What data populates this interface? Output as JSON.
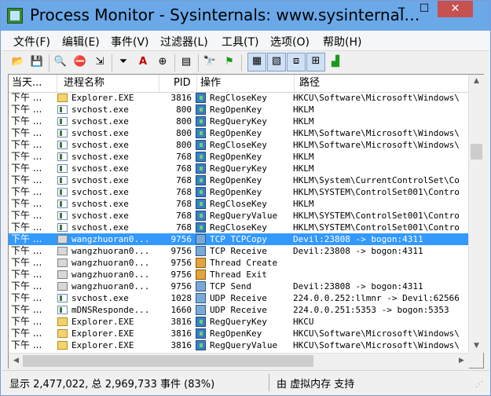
{
  "window": {
    "title": "Process Monitor - Sysinternals: www.sysinternal…",
    "minimize_glyph": "─",
    "maximize_glyph": "☐",
    "close_glyph": "✕"
  },
  "menu": [
    "文件(F)",
    "编辑(E)",
    "事件(V)",
    "过滤器(L)",
    "工具(T)",
    "选项(O)",
    "帮助(H)"
  ],
  "toolbar": {
    "buttons": [
      {
        "icon": "open-folder-icon",
        "glyph": "📂"
      },
      {
        "icon": "save-icon",
        "glyph": "💾"
      },
      {
        "icon": "magnify-icon",
        "glyph": "🔍"
      },
      {
        "icon": "capture-toggle-icon",
        "glyph": "⛔"
      },
      {
        "icon": "autoscroll-icon",
        "glyph": "⇲"
      },
      {
        "icon": "filter-icon",
        "glyph": "⏷"
      },
      {
        "icon": "highlight-icon",
        "glyph": "A"
      },
      {
        "icon": "target-icon",
        "glyph": "⊕"
      },
      {
        "icon": "jump-icon",
        "glyph": "▤"
      },
      {
        "icon": "find-icon",
        "glyph": "🔭"
      },
      {
        "icon": "jump-to-icon",
        "glyph": "⚑"
      },
      {
        "icon": "registry-activity-icon",
        "glyph": "▦"
      },
      {
        "icon": "filesystem-activity-icon",
        "glyph": "▧"
      },
      {
        "icon": "network-activity-icon",
        "glyph": "⧈"
      },
      {
        "icon": "process-activity-icon",
        "glyph": "⊞"
      },
      {
        "icon": "profiling-activity-icon",
        "glyph": "▟"
      }
    ]
  },
  "columns": {
    "time": "当天...",
    "process": "进程名称",
    "pid": "PID",
    "operation": "操作",
    "path": "路径"
  },
  "rows": [
    {
      "time": "下午 ...",
      "pkind": "explorer",
      "process": "Explorer.EXE",
      "pid": "3816",
      "okind": "reg",
      "operation": "RegCloseKey",
      "path": "HKCU\\Software\\Microsoft\\Windows\\"
    },
    {
      "time": "下午 ...",
      "pkind": "svc",
      "process": "svchost.exe",
      "pid": "800",
      "okind": "reg",
      "operation": "RegOpenKey",
      "path": "HKLM"
    },
    {
      "time": "下午 ...",
      "pkind": "svc",
      "process": "svchost.exe",
      "pid": "800",
      "okind": "reg",
      "operation": "RegQueryKey",
      "path": "HKLM"
    },
    {
      "time": "下午 ...",
      "pkind": "svc",
      "process": "svchost.exe",
      "pid": "800",
      "okind": "reg",
      "operation": "RegOpenKey",
      "path": "HKLM\\Software\\Microsoft\\Windows\\"
    },
    {
      "time": "下午 ...",
      "pkind": "svc",
      "process": "svchost.exe",
      "pid": "800",
      "okind": "reg",
      "operation": "RegCloseKey",
      "path": "HKLM\\Software\\Microsoft\\Windows\\"
    },
    {
      "time": "下午 ...",
      "pkind": "svc",
      "process": "svchost.exe",
      "pid": "768",
      "okind": "reg",
      "operation": "RegOpenKey",
      "path": "HKLM"
    },
    {
      "time": "下午 ...",
      "pkind": "svc",
      "process": "svchost.exe",
      "pid": "768",
      "okind": "reg",
      "operation": "RegQueryKey",
      "path": "HKLM"
    },
    {
      "time": "下午 ...",
      "pkind": "svc",
      "process": "svchost.exe",
      "pid": "768",
      "okind": "reg",
      "operation": "RegOpenKey",
      "path": "HKLM\\System\\CurrentControlSet\\Co"
    },
    {
      "time": "下午 ...",
      "pkind": "svc",
      "process": "svchost.exe",
      "pid": "768",
      "okind": "reg",
      "operation": "RegOpenKey",
      "path": "HKLM\\SYSTEM\\ControlSet001\\Contro"
    },
    {
      "time": "下午 ...",
      "pkind": "svc",
      "process": "svchost.exe",
      "pid": "768",
      "okind": "reg",
      "operation": "RegCloseKey",
      "path": "HKLM"
    },
    {
      "time": "下午 ...",
      "pkind": "svc",
      "process": "svchost.exe",
      "pid": "768",
      "okind": "reg",
      "operation": "RegQueryValue",
      "path": "HKLM\\SYSTEM\\ControlSet001\\Contro"
    },
    {
      "time": "下午 ...",
      "pkind": "svc",
      "process": "svchost.exe",
      "pid": "768",
      "okind": "reg",
      "operation": "RegCloseKey",
      "path": "HKLM\\SYSTEM\\ControlSet001\\Contro"
    },
    {
      "time": "下午 ...",
      "pkind": "app",
      "process": "wangzhuoran0...",
      "pid": "9756",
      "okind": "net",
      "operation": "TCP TCPCopy",
      "path": "Devil:23808 -> bogon:4311",
      "selected": true
    },
    {
      "time": "下午 ...",
      "pkind": "app",
      "process": "wangzhuoran0...",
      "pid": "9756",
      "okind": "net",
      "operation": "TCP Receive",
      "path": "Devil:23808 -> bogon:4311"
    },
    {
      "time": "下午 ...",
      "pkind": "app",
      "process": "wangzhuoran0...",
      "pid": "9756",
      "okind": "thr",
      "operation": "Thread Create",
      "path": ""
    },
    {
      "time": "下午 ...",
      "pkind": "app",
      "process": "wangzhuoran0...",
      "pid": "9756",
      "okind": "thr",
      "operation": "Thread Exit",
      "path": ""
    },
    {
      "time": "下午 ...",
      "pkind": "app",
      "process": "wangzhuoran0...",
      "pid": "9756",
      "okind": "net",
      "operation": "TCP Send",
      "path": "Devil:23808 -> bogon:4311"
    },
    {
      "time": "下午 ...",
      "pkind": "svc",
      "process": "svchost.exe",
      "pid": "1028",
      "okind": "net",
      "operation": "UDP Receive",
      "path": "224.0.0.252:llmnr -> Devil:62566"
    },
    {
      "time": "下午 ...",
      "pkind": "svc",
      "process": "mDNSResponde...",
      "pid": "1660",
      "okind": "net",
      "operation": "UDP Receive",
      "path": "224.0.0.251:5353 -> bogon:5353"
    },
    {
      "time": "下午 ...",
      "pkind": "explorer",
      "process": "Explorer.EXE",
      "pid": "3816",
      "okind": "reg",
      "operation": "RegQueryKey",
      "path": "HKCU"
    },
    {
      "time": "下午 ...",
      "pkind": "explorer",
      "process": "Explorer.EXE",
      "pid": "3816",
      "okind": "reg",
      "operation": "RegOpenKey",
      "path": "HKCU\\Software\\Microsoft\\Windows\\"
    },
    {
      "time": "下午 ...",
      "pkind": "explorer",
      "process": "Explorer.EXE",
      "pid": "3816",
      "okind": "reg",
      "operation": "RegQueryValue",
      "path": "HKCU\\Software\\Microsoft\\Windows\\"
    }
  ],
  "status": {
    "left": "显示 2,477,022, 总 2,969,733 事件 (83%)",
    "right": "由 虚拟内存 支持"
  },
  "colors": {
    "selected_row": "#3399ff",
    "title_bar": "#6aa8e8",
    "close_button": "#c75050"
  }
}
